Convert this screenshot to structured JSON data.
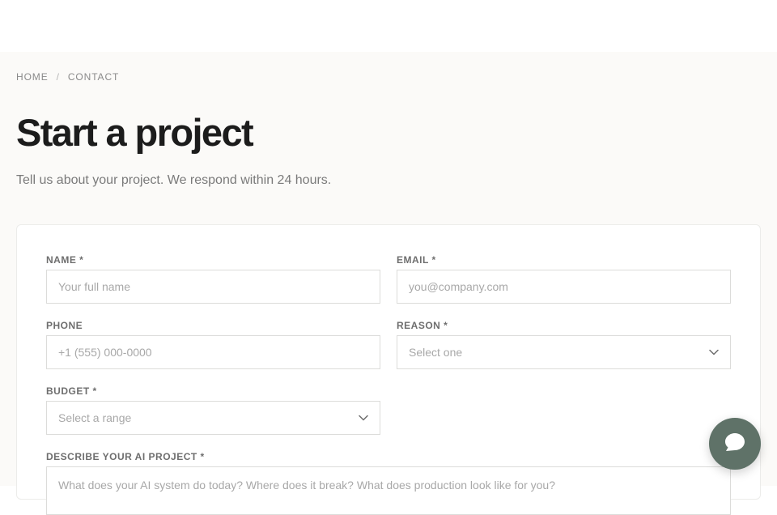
{
  "breadcrumb": {
    "home": "HOME",
    "separator": "/",
    "current": "CONTACT"
  },
  "page": {
    "title": "Start a project",
    "subtitle": "Tell us about your project. We respond within 24 hours."
  },
  "form": {
    "name": {
      "label": "NAME *",
      "placeholder": "Your full name",
      "value": ""
    },
    "email": {
      "label": "EMAIL *",
      "placeholder": "you@company.com",
      "value": ""
    },
    "phone": {
      "label": "PHONE",
      "placeholder": "+1 (555) 000-0000",
      "value": ""
    },
    "reason": {
      "label": "REASON *",
      "selected": "Select one"
    },
    "budget": {
      "label": "BUDGET *",
      "selected": "Select a range"
    },
    "description": {
      "label": "DESCRIBE YOUR AI PROJECT *",
      "placeholder": "What does your AI system do today? Where does it break? What does production look like for you?"
    }
  },
  "icons": {
    "select_chevron": "chevron-down-icon",
    "chat": "chat-bubble-icon"
  },
  "colors": {
    "page_background": "#fbfaf8",
    "title": "#1c1c1c",
    "muted_text": "#7a7a7a",
    "chat_button": "#5f7268",
    "border": "#dcdcda"
  }
}
